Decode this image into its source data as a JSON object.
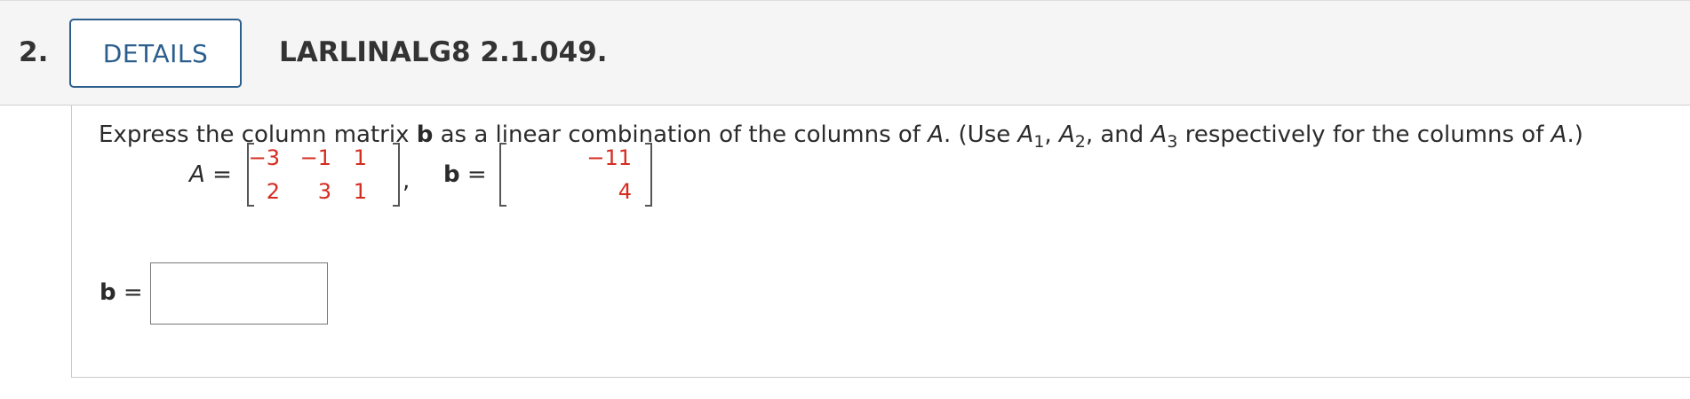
{
  "header": {
    "question_number": "2.",
    "details_label": "DETAILS",
    "problem_id": "LARLINALG8 2.1.049."
  },
  "prompt": {
    "part1": "Express the column matrix ",
    "b_symbol": "b",
    "part2": " as a linear combination of the columns of ",
    "A_symbol": "A",
    "part3": ". (Use ",
    "A1": "A",
    "A1_sub": "1",
    "sep1": ", ",
    "A2": "A",
    "A2_sub": "2",
    "sep2": ", and ",
    "A3": "A",
    "A3_sub": "3",
    "part4": " respectively for the columns of ",
    "A_symbol2": "A",
    "part5": ".)"
  },
  "matrix_A": {
    "label": "A",
    "equals": "=",
    "rows": [
      [
        "−3",
        "−1",
        "1"
      ],
      [
        "2",
        "3",
        "1"
      ]
    ]
  },
  "separator": ",",
  "vector_b": {
    "label": "b",
    "equals": "=",
    "rows": [
      [
        "−11"
      ],
      [
        "4"
      ]
    ]
  },
  "answer": {
    "label": "b",
    "equals": "=",
    "value": ""
  }
}
